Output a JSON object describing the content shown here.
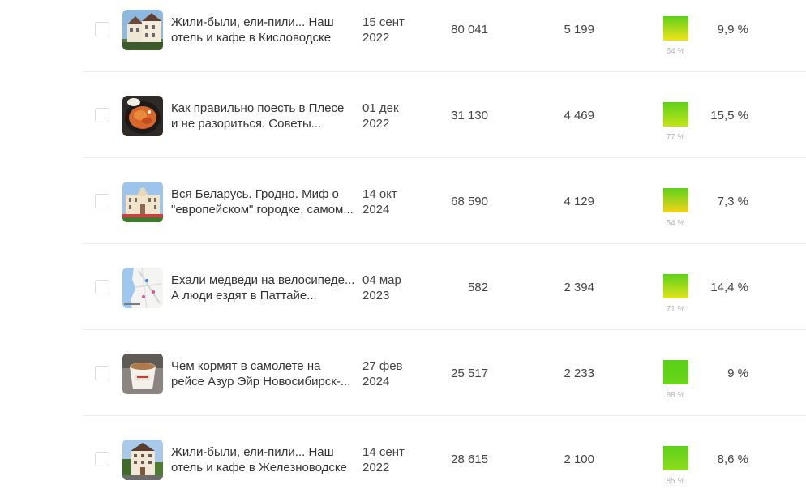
{
  "rows": [
    {
      "thumb_icon": "hotel-building-photo",
      "title_lines": [
        "Жили-были, ели-пили... Наш",
        "отель и кафе в Кисловодске"
      ],
      "date_lines": [
        "15 сент",
        "2022"
      ],
      "views": "80 041",
      "reads": "5 199",
      "read_rate": 64,
      "read_rate_label": "64 %",
      "gauge_color_top": "#5ed11a",
      "gauge_color_bottom": "#f2e31a",
      "ctr": "9,9 %"
    },
    {
      "thumb_icon": "food-plate-photo",
      "title_lines": [
        "Как правильно поесть в Плесе",
        "и не разориться. Советы..."
      ],
      "date_lines": [
        "01 дек",
        "2022"
      ],
      "views": "31 130",
      "reads": "4 469",
      "read_rate": 77,
      "read_rate_label": "77 %",
      "gauge_color_top": "#5ed11a",
      "gauge_color_bottom": "#c3e41a",
      "ctr": "15,5 %"
    },
    {
      "thumb_icon": "palace-building-photo",
      "title_lines": [
        "Вся Беларусь. Гродно. Миф о",
        "\"европейском\" городке, самом..."
      ],
      "date_lines": [
        "14 окт",
        "2024"
      ],
      "views": "68 590",
      "reads": "4 129",
      "read_rate": 54,
      "read_rate_label": "54 %",
      "gauge_color_top": "#5ed11a",
      "gauge_color_bottom": "#f4d21a",
      "ctr": "7,3 %"
    },
    {
      "thumb_icon": "map-screenshot-photo",
      "title_lines": [
        "Ехали медведи на велосипеде...",
        "А люди ездят в Паттайе..."
      ],
      "date_lines": [
        "04 мар",
        "2023"
      ],
      "views": "582",
      "reads": "2 394",
      "read_rate": 71,
      "read_rate_label": "71 %",
      "gauge_color_top": "#5ed11a",
      "gauge_color_bottom": "#e1e41a",
      "ctr": "14,4 %"
    },
    {
      "thumb_icon": "coffee-cup-photo",
      "title_lines": [
        "Чем кормят в самолете на",
        "рейсе Азур Эйр Новосибирск-..."
      ],
      "date_lines": [
        "27 фев",
        "2024"
      ],
      "views": "25 517",
      "reads": "2 233",
      "read_rate": 88,
      "read_rate_label": "88 %",
      "gauge_color_top": "#58d016",
      "gauge_color_bottom": "#6ad61a",
      "ctr": "9 %"
    },
    {
      "thumb_icon": "hotel-building-photo",
      "title_lines": [
        "Жили-были, ели-пили... Наш",
        "отель и кафе в Железноводске"
      ],
      "date_lines": [
        "14 сент",
        "2022"
      ],
      "views": "28 615",
      "reads": "2 100",
      "read_rate": 85,
      "read_rate_label": "85 %",
      "gauge_color_top": "#5ed11a",
      "gauge_color_bottom": "#8ddc1a",
      "ctr": "8,6 %"
    }
  ]
}
